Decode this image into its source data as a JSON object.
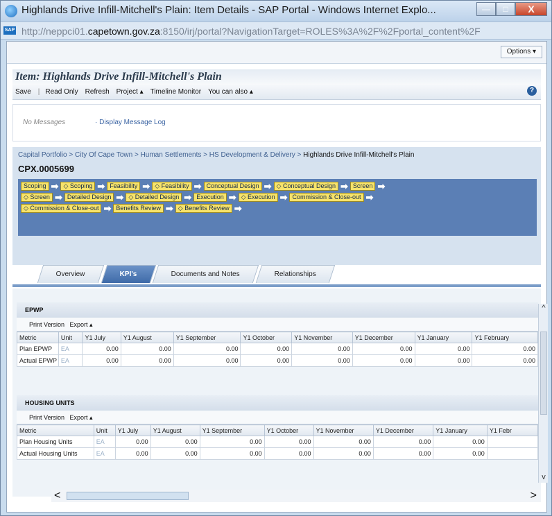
{
  "window": {
    "title": "Highlands Drive Infill-Mitchell's Plain: Item Details - SAP Portal - Windows Internet Explo...",
    "url_prefix": "http://neppci01.",
    "url_domain": "capetown.gov.za",
    "url_rest": ":8150/irj/portal?NavigationTarget=ROLES%3A%2F%2Fportal_content%2F",
    "minimize": "—",
    "maximize": "□",
    "close": "X"
  },
  "topbar": {
    "options": "Options ▾"
  },
  "item": {
    "title": "Item: Highlands Drive Infill-Mitchell's Plain"
  },
  "toolbar": {
    "save": "Save",
    "sep": "|",
    "read_only": "Read Only",
    "refresh": "Refresh",
    "project": "Project ▴",
    "timeline": "Timeline Monitor",
    "you_can_also": "You can also ▴",
    "help": "?"
  },
  "messages": {
    "none": "No Messages",
    "display_log": "· Display Message Log"
  },
  "breadcrumb": {
    "path": "Capital Portfolio > City Of Cape Town > Human Settlements > HS Development & Delivery > ",
    "current": "Highlands Drive Infill-Mitchell's Plain"
  },
  "cpx_id": "CPX.0005699",
  "phases": {
    "row1": [
      "Scoping",
      "◇ Scoping",
      "Feasibility",
      "◇ Feasibility",
      "Conceptual Design",
      "◇ Conceptual Design",
      "Screen"
    ],
    "row2": [
      "◇ Screen",
      "Detailed Design",
      "◇ Detailed Design",
      "Execution",
      "◇ Execution",
      "Commission & Close-out"
    ],
    "row3": [
      "◇ Commission & Close-out",
      "Benefits Review",
      "◇ Benefits Review"
    ],
    "arrow": "➡"
  },
  "tabs": [
    "Overview",
    "KPI's",
    "Documents and Notes",
    "Relationships"
  ],
  "epwp": {
    "title": "EPWP",
    "print": "Print Version",
    "export": "Export ▴",
    "columns": [
      "Metric",
      "Unit",
      "Y1 July",
      "Y1 August",
      "Y1 September",
      "Y1 October",
      "Y1 November",
      "Y1 December",
      "Y1 January",
      "Y1 February"
    ],
    "rows": [
      [
        "Plan EPWP",
        "EA",
        "0.00",
        "0.00",
        "0.00",
        "0.00",
        "0.00",
        "0.00",
        "0.00",
        "0.00"
      ],
      [
        "Actual EPWP",
        "EA",
        "0.00",
        "0.00",
        "0.00",
        "0.00",
        "0.00",
        "0.00",
        "0.00",
        "0.00"
      ]
    ]
  },
  "housing": {
    "title": "HOUSING UNITS",
    "print": "Print Version",
    "export": "Export ▴",
    "columns": [
      "Metric",
      "Unit",
      "Y1 July",
      "Y1 August",
      "Y1 September",
      "Y1 October",
      "Y1 November",
      "Y1 December",
      "Y1 January",
      "Y1 Febr"
    ],
    "rows": [
      [
        "Plan Housing Units",
        "EA",
        "0.00",
        "0.00",
        "0.00",
        "0.00",
        "0.00",
        "0.00",
        "0.00",
        ""
      ],
      [
        "Actual Housing Units",
        "EA",
        "0.00",
        "0.00",
        "0.00",
        "0.00",
        "0.00",
        "0.00",
        "0.00",
        ""
      ]
    ]
  },
  "scroll": {
    "up": "^",
    "down": "v",
    "left": "<",
    "right": ">"
  }
}
